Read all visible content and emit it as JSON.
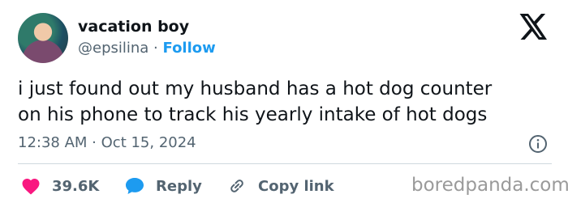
{
  "author": {
    "name": "vacation boy",
    "handle": "@epsilina",
    "separator": " · ",
    "follow_label": "Follow"
  },
  "logo_icon": "x-logo-icon",
  "tweet": {
    "text_line1": "i just found out my husband has a hot dog counter",
    "text_line2": "on his phone to track his yearly intake of hot dogs",
    "time": "12:38 AM",
    "dot": " · ",
    "date": "Oct 15, 2024"
  },
  "actions": {
    "like_count": "39.6K",
    "reply_label": "Reply",
    "copy_link_label": "Copy link"
  },
  "watermark": "boredpanda.com",
  "colors": {
    "accent": "#1d9bf0",
    "like": "#f91880",
    "text": "#0f1419",
    "muted": "#536471"
  }
}
